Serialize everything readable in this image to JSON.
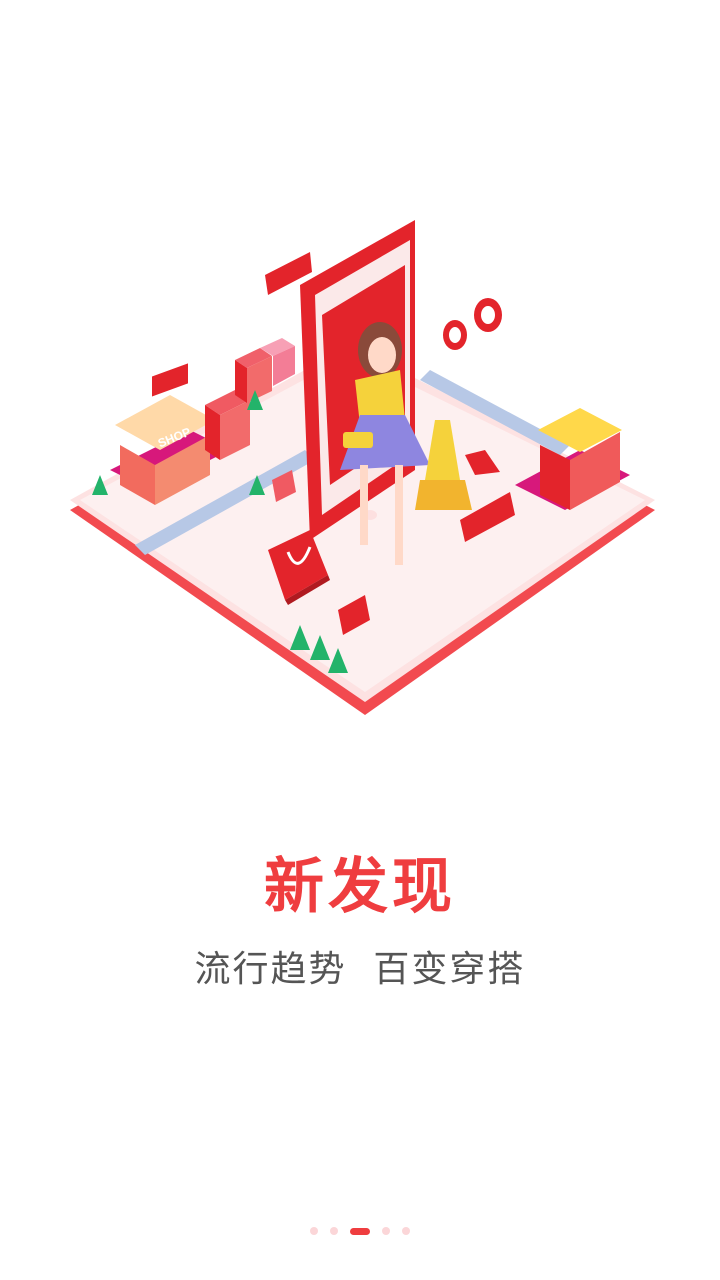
{
  "onboarding": {
    "title": "新发现",
    "subtitle": "流行趋势  百变穿搭",
    "illustration_sign": "SHOP",
    "page_count": 5,
    "active_page": 3
  },
  "colors": {
    "accent": "#ef3d3f",
    "subtitle_text": "#555555",
    "dot_inactive": "#fbd6d8"
  }
}
